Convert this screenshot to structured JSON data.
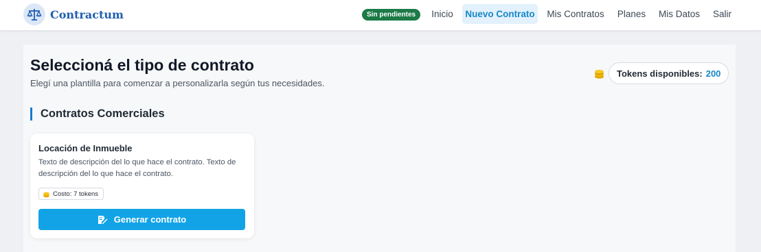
{
  "app": {
    "name": "Contractum",
    "logo_icon": "balance-scale-icon"
  },
  "nav": {
    "badge": "Sin pendientes",
    "links": [
      {
        "label": "Inicio",
        "active": false
      },
      {
        "label": "Nuevo Contrato",
        "active": true
      },
      {
        "label": "Mis Contratos",
        "active": false
      },
      {
        "label": "Planes",
        "active": false
      },
      {
        "label": "Mis Datos",
        "active": false
      },
      {
        "label": "Salir",
        "active": false
      }
    ]
  },
  "page": {
    "title": "Seleccioná el tipo de contrato",
    "subtitle": "Elegí una plantilla para comenzar a personalizarla según tus necesidades."
  },
  "tokens": {
    "label": "Tokens disponibles:",
    "count": "200",
    "icon": "coins-icon"
  },
  "section": {
    "title": "Contratos Comerciales"
  },
  "cards": [
    {
      "title": "Locación de Inmueble",
      "description": "Texto de descripción del lo que hace el contrato. Texto de descripción del lo que hace el contrato.",
      "cost": "Costo: 7 tokens",
      "button_label": "Generar contrato",
      "button_icon": "file-signature-icon"
    }
  ],
  "colors": {
    "brand": "#1f5fae",
    "accent": "#12a3e6",
    "active_nav": "#1787c7",
    "badge_green": "#1b7a47",
    "coin": "#f2b705"
  }
}
